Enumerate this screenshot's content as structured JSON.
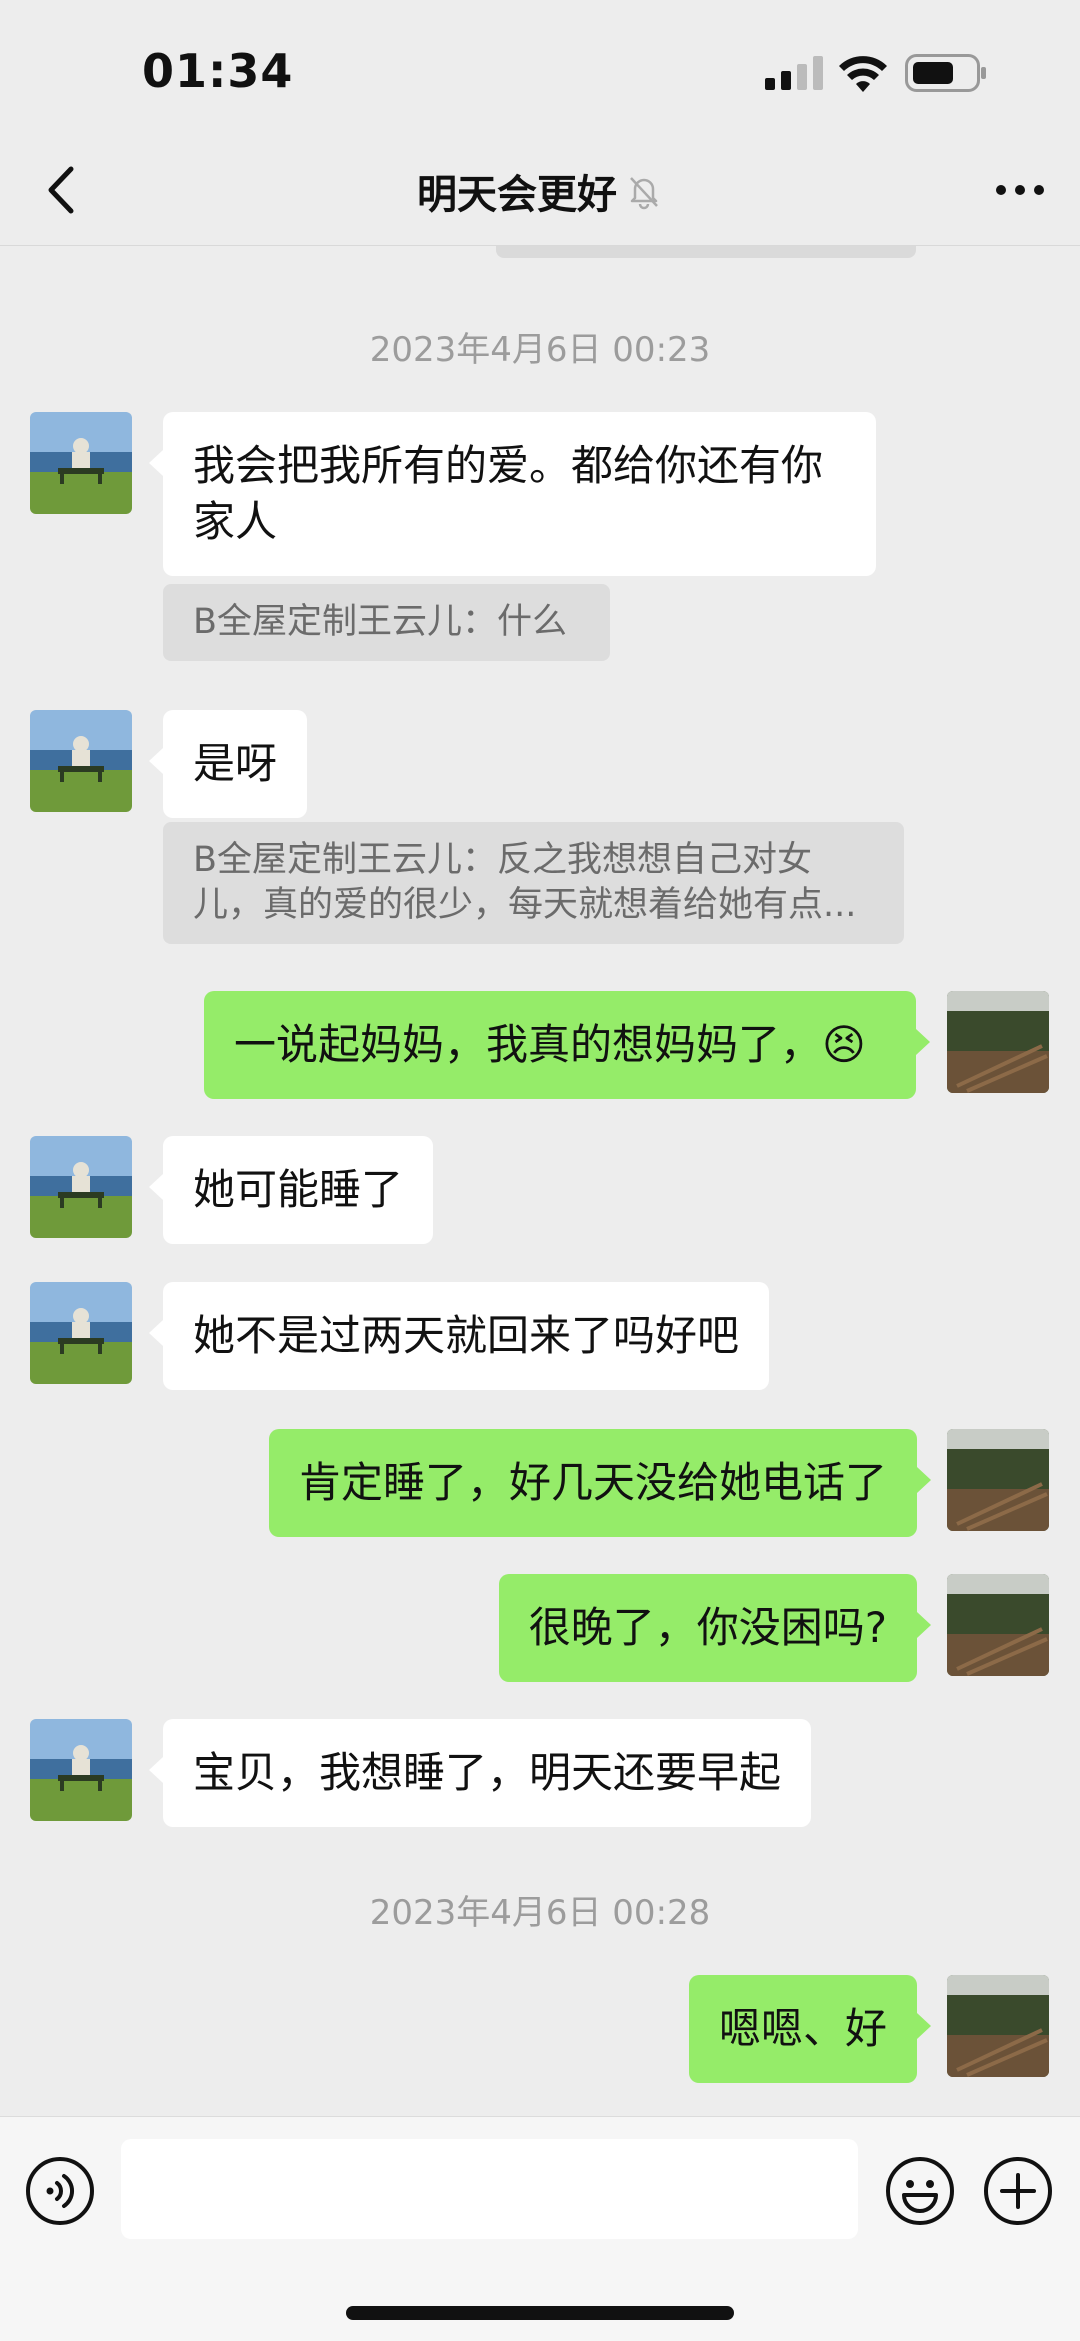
{
  "status_bar": {
    "time": "01:34"
  },
  "nav": {
    "title": "明天会更好"
  },
  "timestamps": [
    "2023年4月6日 00:23",
    "2023年4月6日 00:28"
  ],
  "messages": [
    {
      "side": "in",
      "text": "我会把我所有的爱。都给你还有你家人",
      "quote": "B全屋定制王云儿：什么"
    },
    {
      "side": "in",
      "text": "是呀",
      "quote": "B全屋定制王云儿：反之我想想自己对女儿，真的爱的很少，每天就想着给她有点..."
    },
    {
      "side": "out",
      "text": "一说起妈妈，我真的想妈妈了，😣"
    },
    {
      "side": "in",
      "text": "她可能睡了"
    },
    {
      "side": "in",
      "text": "她不是过两天就回来了吗好吧"
    },
    {
      "side": "out",
      "text": "肯定睡了，好几天没给她电话了"
    },
    {
      "side": "out",
      "text": "很晚了，你没困吗?"
    },
    {
      "side": "in",
      "text": "宝贝，我想睡了，明天还要早起"
    },
    {
      "side": "out",
      "text": "嗯嗯、好"
    }
  ],
  "input": {
    "value": ""
  },
  "colors": {
    "background": "#ededed",
    "outgoing_bubble": "#95ec69",
    "incoming_bubble": "#ffffff"
  }
}
